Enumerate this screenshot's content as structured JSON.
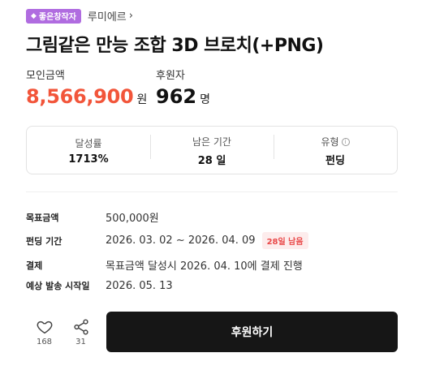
{
  "badge": {
    "icon": "diamond-icon",
    "label": "좋은창작자",
    "color": "#b06ce0"
  },
  "creator": {
    "name": "루미에르",
    "chevron_icon": "chevron-right-icon"
  },
  "title": "그림같은 만능 조합 3D 브로치(+PNG)",
  "amount": {
    "label": "모인금액",
    "value": "8,566,900",
    "unit": "원",
    "color": "#f2553a"
  },
  "backers": {
    "label": "후원자",
    "value": "962",
    "unit": "명"
  },
  "summary": [
    {
      "label": "달성률",
      "value": "1713%"
    },
    {
      "label": "남은 기간",
      "value": "28 일"
    },
    {
      "label": "유형",
      "value": "펀딩",
      "icon": "info-icon"
    }
  ],
  "details": {
    "goal": {
      "label": "목표금액",
      "value": "500,000원"
    },
    "period": {
      "label": "펀딩 기간",
      "value": "2026. 03. 02 ~ 2026. 04. 09",
      "badge": "28일 남음"
    },
    "payment": {
      "label": "결제",
      "value": "목표금액 달성시 2026. 04. 10에 결제 진행"
    },
    "delivery": {
      "label": "예상 발송 시작일",
      "value": "2026. 05. 13"
    }
  },
  "actions": {
    "like": {
      "icon": "heart-icon",
      "count": "168"
    },
    "share": {
      "icon": "share-icon",
      "count": "31"
    },
    "support_label": "후원하기"
  }
}
